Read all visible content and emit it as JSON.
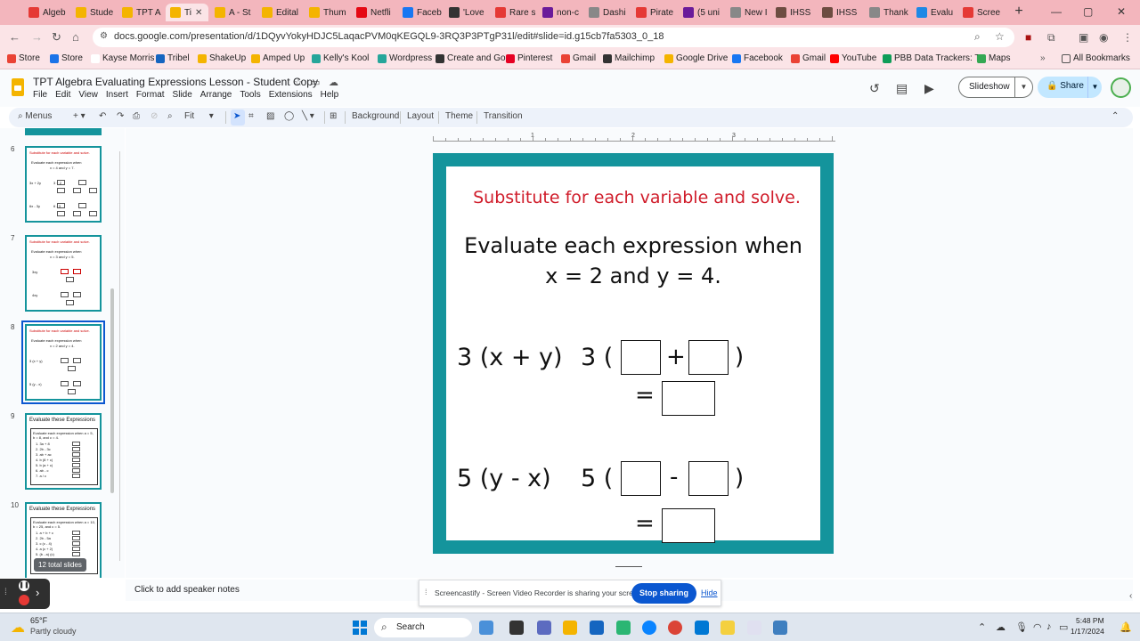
{
  "browser": {
    "tabs": [
      {
        "label": "Algeb",
        "color": "#e53935"
      },
      {
        "label": "Stude",
        "color": "#f4b400"
      },
      {
        "label": "TPT A",
        "color": "#f4b400"
      },
      {
        "label": "Ti",
        "color": "#f4b400",
        "active": true
      },
      {
        "label": "A - St",
        "color": "#f4b400"
      },
      {
        "label": "Edital",
        "color": "#f4b400"
      },
      {
        "label": "Thum",
        "color": "#f4b400"
      },
      {
        "label": "Netfli",
        "color": "#e50914"
      },
      {
        "label": "Faceb",
        "color": "#1877f2"
      },
      {
        "label": "'Love",
        "color": "#333333"
      },
      {
        "label": "Rare s",
        "color": "#e53935"
      },
      {
        "label": "non-c",
        "color": "#6a1b9a"
      },
      {
        "label": "Dashi",
        "color": "#888888"
      },
      {
        "label": "Pirate",
        "color": "#e53935"
      },
      {
        "label": "(5 uni",
        "color": "#6a1b9a"
      },
      {
        "label": "New I",
        "color": "#888888"
      },
      {
        "label": "IHSS",
        "color": "#6d4c41"
      },
      {
        "label": "IHSS",
        "color": "#6d4c41"
      },
      {
        "label": "Thank",
        "color": "#888888"
      },
      {
        "label": "Evalu",
        "color": "#1e88e5"
      },
      {
        "label": "Scree",
        "color": "#e53935"
      }
    ],
    "url": "docs.google.com/presentation/d/1DQyvYokyHDJC5LaqacPVM0qKEGQL9-3RQ3P3PTgP31l/edit#slide=id.g15cb7fa5303_0_18",
    "bookmarks": [
      {
        "label": "Store",
        "color": "#ea4335"
      },
      {
        "label": "Store",
        "color": "#1a73e8"
      },
      {
        "label": "Kayse Morris",
        "color": "#ffffff"
      },
      {
        "label": "Tribel",
        "color": "#1565c0"
      },
      {
        "label": "ShakeUp",
        "color": "#f4b400"
      },
      {
        "label": "Amped Up",
        "color": "#f4b400"
      },
      {
        "label": "Kelly's Kool",
        "color": "#26a69a"
      },
      {
        "label": "Wordpress",
        "color": "#26a69a"
      },
      {
        "label": "Create and Go",
        "color": "#333333"
      },
      {
        "label": "Pinterest",
        "color": "#e60023"
      },
      {
        "label": "Gmail",
        "color": "#ea4335"
      },
      {
        "label": "Mailchimp",
        "color": "#333333"
      },
      {
        "label": "Google Drive",
        "color": "#f4b400"
      },
      {
        "label": "Facebook",
        "color": "#1877f2"
      },
      {
        "label": "Gmail",
        "color": "#ea4335"
      },
      {
        "label": "YouTube",
        "color": "#ff0000"
      },
      {
        "label": "PBB Data Trackers: T...",
        "color": "#0f9d58"
      },
      {
        "label": "Maps",
        "color": "#34a853"
      }
    ],
    "all_bookmarks": "All Bookmarks"
  },
  "doc": {
    "title": "TPT Algebra Evaluating Expressions Lesson - Student Copy",
    "menu": [
      "File",
      "Edit",
      "View",
      "Insert",
      "Format",
      "Slide",
      "Arrange",
      "Tools",
      "Extensions",
      "Help"
    ],
    "slideshow_label": "Slideshow",
    "share_label": "Share"
  },
  "toolbar": {
    "menus_label": "Menus",
    "zoom_label": "Fit",
    "background_label": "Background",
    "layout_label": "Layout",
    "theme_label": "Theme",
    "transition_label": "Transition"
  },
  "filmstrip": {
    "slides": [
      {
        "number": "6",
        "instruction": "Substitute for each variable and solve.",
        "line1": "Evaluate each expression when",
        "line2": "x = 4 and y = 7.",
        "expr1": "3x + 2y",
        "expr1_coeffs": "3     + 2",
        "expr2": "6x - 3y",
        "expr2_coeffs": "6     - 3"
      },
      {
        "number": "7",
        "instruction": "Substitute for each variable and solve.",
        "line1": "Evaluate each expression when",
        "line2": "x = 3 and y = 5.",
        "expr1": "3xy",
        "expr1_coeffs": "3 ·  3  ·  5",
        "expr2": "4xy",
        "expr2_coeffs": "4 ·     ·"
      },
      {
        "number": "8",
        "instruction": "Substitute for each variable and solve.",
        "line1": "Evaluate each expression when",
        "line2": "x = 2 and y = 4.",
        "expr1": "3 (x + y)",
        "expr1_coeffs": "3 (     +     )",
        "expr2": "5 (y - x)",
        "expr2_coeffs": "5 (     -     )"
      },
      {
        "number": "9",
        "heading": "Evaluate these Expressions",
        "card_line1": "Evaluate each expression when a = 5,",
        "card_line2": "b = 8, and c = 4.",
        "items": [
          "1.  3a + 8",
          "2.  2b - 3c",
          "3.  ab + ac",
          "4.  b (8 + c)",
          "5.  b (a + c)",
          "6.  ab - c",
          "7.  a / c"
        ]
      },
      {
        "number": "10",
        "heading": "Evaluate these Expressions",
        "card_line1": "Evaluate each expression when a = 10,",
        "card_line2": "b = 25, and c = 5.",
        "items": [
          "1.  a + b + c",
          "2.  2b - 5a",
          "3.  c (c - 4)",
          "4.  a (c + 2)",
          "5.  (b - a) (c)"
        ]
      }
    ],
    "total_slides": "12 total slides"
  },
  "slide": {
    "instruction": "Substitute for each variable and solve.",
    "eval_line1": "Evaluate each expression when",
    "eval_line2": "x = 2 and y = 4.",
    "problem1": {
      "expr": "3 (x + y)",
      "coeff": "3 (",
      "op": "+",
      "close": ")",
      "eq": "="
    },
    "problem2": {
      "expr": "5 (y - x)",
      "coeff": "5 (",
      "op": "-",
      "close": ")",
      "eq": "="
    },
    "ruler_numbers": [
      "1",
      "2",
      "3"
    ]
  },
  "notes": {
    "placeholder": "Click to add speaker notes"
  },
  "screencastify": {
    "message": "Screencastify - Screen Video Recorder is sharing your screen.",
    "stop_label": "Stop sharing",
    "hide_label": "Hide"
  },
  "taskbar": {
    "weather_temp": "65°F",
    "weather_desc": "Partly cloudy",
    "search_label": "Search",
    "time": "5:48 PM",
    "date": "1/17/2024"
  }
}
